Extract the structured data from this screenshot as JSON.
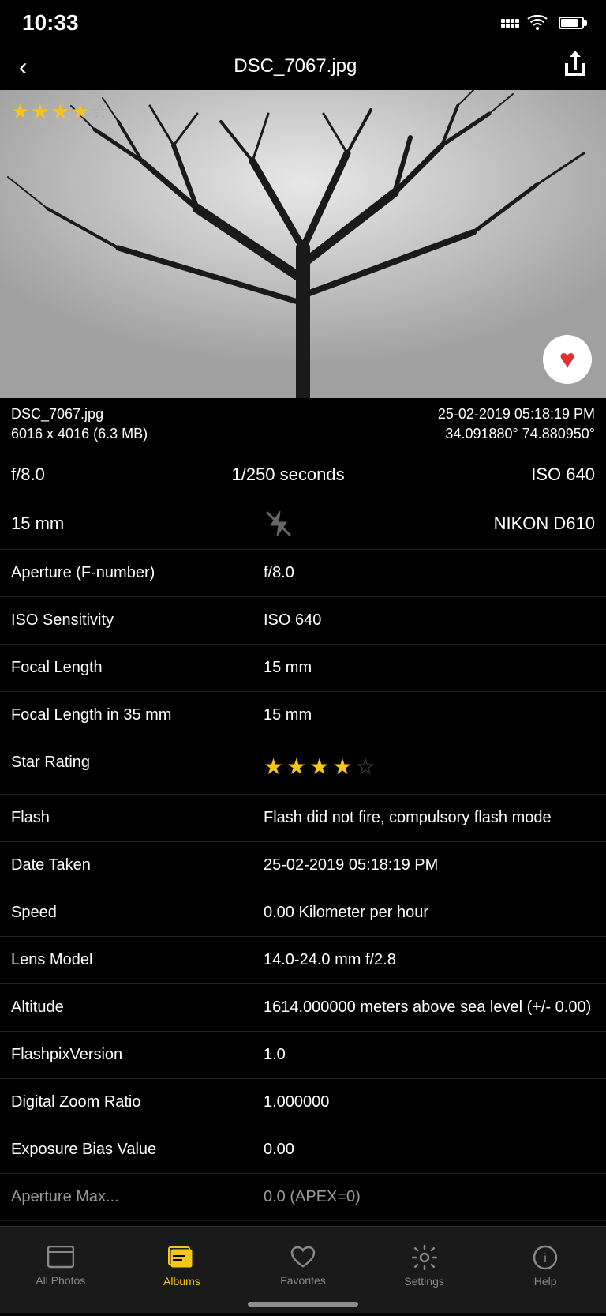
{
  "statusBar": {
    "time": "10:33"
  },
  "navBar": {
    "title": "DSC_7067.jpg",
    "backLabel": "‹",
    "shareLabel": "⬆"
  },
  "photo": {
    "starRating": "★★★★",
    "starEmpty": "☆"
  },
  "photoInfoStrip": {
    "filename": "DSC_7067.jpg",
    "date": "25-02-2019 05:18:19 PM",
    "dimensions": "6016 x 4016 (6.3 MB)",
    "coordinates": "34.091880° 74.880950°"
  },
  "quickExif": {
    "aperture": "f/8.0",
    "shutter": "1/250 seconds",
    "iso": "ISO 640",
    "focalLength": "15 mm",
    "camera": "NIKON D610"
  },
  "details": [
    {
      "label": "Aperture (F-number)",
      "value": "f/8.0"
    },
    {
      "label": "ISO Sensitivity",
      "value": "ISO 640"
    },
    {
      "label": "Focal Length",
      "value": "15 mm"
    },
    {
      "label": "Focal Length in 35 mm",
      "value": "15 mm"
    },
    {
      "label": "Star Rating",
      "value": "★★★★☆",
      "isStars": true,
      "filledCount": 4,
      "emptyCount": 1
    },
    {
      "label": "Flash",
      "value": "Flash did not fire, compulsory flash mode"
    },
    {
      "label": "Date Taken",
      "value": "25-02-2019 05:18:19 PM"
    },
    {
      "label": "Speed",
      "value": "0.00 Kilometer per hour"
    },
    {
      "label": "Lens Model",
      "value": "14.0-24.0 mm f/2.8"
    },
    {
      "label": "Altitude",
      "value": "1614.000000 meters above sea level (+/- 0.00)"
    },
    {
      "label": "FlashpixVersion",
      "value": "1.0"
    },
    {
      "label": "Digital Zoom Ratio",
      "value": "1.000000"
    },
    {
      "label": "Exposure Bias Value",
      "value": "0.00"
    }
  ],
  "tabBar": {
    "items": [
      {
        "id": "all-photos",
        "label": "All Photos",
        "icon": "▢",
        "active": false
      },
      {
        "id": "albums",
        "label": "Albums",
        "icon": "🖼",
        "active": true
      },
      {
        "id": "favorites",
        "label": "Favorites",
        "icon": "♡",
        "active": false
      },
      {
        "id": "settings",
        "label": "Settings",
        "icon": "⚙",
        "active": false
      },
      {
        "id": "help",
        "label": "Help",
        "icon": "ⓘ",
        "active": false
      }
    ]
  },
  "colors": {
    "accent": "#f5c518",
    "background": "#000000",
    "surface": "#1a1a1a",
    "border": "#333333"
  }
}
